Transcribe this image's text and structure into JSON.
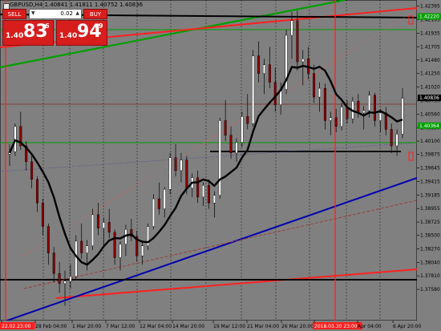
{
  "header": {
    "symbol_line": "GBPUSD,H4  1.40841 1.41811 1.40752 1.40836"
  },
  "trade_panel": {
    "sell_label": "SELL",
    "buy_label": "BUY",
    "lot_value": "0.02",
    "sell_price_small": "1.40",
    "sell_price_big": "83",
    "sell_price_sup": "6",
    "buy_price_small": "1.40",
    "buy_price_big": "94",
    "buy_price_sup": "9"
  },
  "colors": {
    "background": "#808080",
    "bull_candle": "#ffffff",
    "bear_candle": "#8b0000",
    "support_green": "#00a000",
    "resistance_red": "#ff2020",
    "trend_blue": "#0000b0",
    "moving_average": "#000000"
  },
  "chart_data": {
    "type": "candlestick",
    "symbol": "GBPUSD",
    "timeframe": "H4",
    "ylim": [
      1.3705,
      1.425
    ],
    "price_ticks": [
      "1.42395",
      "1.42165",
      "1.41935",
      "1.41705",
      "1.41480",
      "1.41250",
      "1.41020",
      "1.40790",
      "1.40560",
      "1.40330",
      "1.40100",
      "1.39875",
      "1.39645",
      "1.39415",
      "1.39185",
      "1.38955",
      "1.38725",
      "1.38500",
      "1.38270",
      "1.38040",
      "1.37810",
      "1.37580"
    ],
    "price_tags": [
      {
        "text": "1.42220",
        "price": 1.4222,
        "bg": "#00a000"
      },
      {
        "text": "1.40836",
        "price": 1.40836,
        "bg": "#000000"
      },
      {
        "text": "1.40364",
        "price": 1.40364,
        "bg": "#00a000"
      }
    ],
    "time_labels": [
      "22.02.23:00",
      "28 Feb 04:00",
      "1 Mar 20:00",
      "7 Mar 12:00",
      "12 Mar 04:00",
      "14 Mar 20:00",
      "19 Mar 12:00",
      "21 Mar 04:00",
      "26 Mar 20:00",
      "2018.03.30 23:00",
      "Apr 04:00",
      "6 Apr 20:00"
    ],
    "time_label_highlight": [
      "22.02.23:00",
      "2018.03.30 23:00"
    ],
    "ohlc": [
      [
        1.3988,
        1.4005,
        1.3968,
        1.3992
      ],
      [
        1.3992,
        1.404,
        1.3985,
        1.4035
      ],
      [
        1.4035,
        1.406,
        1.3995,
        1.4002
      ],
      [
        1.4002,
        1.401,
        1.396,
        1.3975
      ],
      [
        1.3975,
        1.399,
        1.393,
        1.3945
      ],
      [
        1.3945,
        1.395,
        1.389,
        1.3905
      ],
      [
        1.3905,
        1.3912,
        1.385,
        1.3865
      ],
      [
        1.3865,
        1.387,
        1.38,
        1.382
      ],
      [
        1.382,
        1.383,
        1.377,
        1.3785
      ],
      [
        1.3785,
        1.3805,
        1.3752,
        1.3768
      ],
      [
        1.3768,
        1.379,
        1.373,
        1.3772
      ],
      [
        1.3772,
        1.38,
        1.376,
        1.378
      ],
      [
        1.378,
        1.385,
        1.3775,
        1.384
      ],
      [
        1.384,
        1.387,
        1.381,
        1.382
      ],
      [
        1.382,
        1.3842,
        1.379,
        1.3832
      ],
      [
        1.3832,
        1.3895,
        1.3825,
        1.3885
      ],
      [
        1.3885,
        1.3905,
        1.385,
        1.3862
      ],
      [
        1.3862,
        1.388,
        1.383,
        1.3872
      ],
      [
        1.3872,
        1.3895,
        1.3845,
        1.3855
      ],
      [
        1.3855,
        1.386,
        1.38,
        1.3812
      ],
      [
        1.3812,
        1.384,
        1.379,
        1.3835
      ],
      [
        1.3835,
        1.3868,
        1.3815,
        1.386
      ],
      [
        1.386,
        1.3878,
        1.384,
        1.3848
      ],
      [
        1.3848,
        1.3858,
        1.3805,
        1.3815
      ],
      [
        1.3815,
        1.384,
        1.38,
        1.3832
      ],
      [
        1.3832,
        1.387,
        1.3825,
        1.3865
      ],
      [
        1.3865,
        1.392,
        1.386,
        1.3912
      ],
      [
        1.3912,
        1.394,
        1.3885,
        1.3895
      ],
      [
        1.3895,
        1.3932,
        1.388,
        1.3928
      ],
      [
        1.3928,
        1.399,
        1.392,
        1.3982
      ],
      [
        1.3982,
        1.4005,
        1.395,
        1.396
      ],
      [
        1.396,
        1.399,
        1.394,
        1.3978
      ],
      [
        1.3978,
        1.3985,
        1.392,
        1.393
      ],
      [
        1.393,
        1.3955,
        1.3915,
        1.3948
      ],
      [
        1.3948,
        1.396,
        1.3905,
        1.3915
      ],
      [
        1.3915,
        1.394,
        1.39,
        1.3935
      ],
      [
        1.3935,
        1.3945,
        1.3895,
        1.3905
      ],
      [
        1.3905,
        1.3925,
        1.388,
        1.3918
      ],
      [
        1.3918,
        1.405,
        1.3912,
        1.4045
      ],
      [
        1.4045,
        1.408,
        1.401,
        1.402
      ],
      [
        1.402,
        1.4035,
        1.398,
        1.399
      ],
      [
        1.399,
        1.4015,
        1.3975,
        1.4008
      ],
      [
        1.4008,
        1.406,
        1.4,
        1.4052
      ],
      [
        1.4052,
        1.409,
        1.403,
        1.404
      ],
      [
        1.404,
        1.4165,
        1.4035,
        1.4155
      ],
      [
        1.4155,
        1.418,
        1.411,
        1.4125
      ],
      [
        1.4125,
        1.415,
        1.409,
        1.414
      ],
      [
        1.414,
        1.417,
        1.41,
        1.411
      ],
      [
        1.411,
        1.4135,
        1.406,
        1.4072
      ],
      [
        1.4072,
        1.411,
        1.4055,
        1.4098
      ],
      [
        1.4098,
        1.42,
        1.409,
        1.419
      ],
      [
        1.419,
        1.423,
        1.415,
        1.4215
      ],
      [
        1.4215,
        1.4232,
        1.413,
        1.4145
      ],
      [
        1.4145,
        1.4165,
        1.4105,
        1.415
      ],
      [
        1.415,
        1.417,
        1.4115,
        1.4125
      ],
      [
        1.4125,
        1.414,
        1.4075,
        1.4085
      ],
      [
        1.4085,
        1.411,
        1.406,
        1.41
      ],
      [
        1.41,
        1.4108,
        1.403,
        1.4045
      ],
      [
        1.4045,
        1.406,
        1.402,
        1.405
      ],
      [
        1.405,
        1.4065,
        1.4025,
        1.4035
      ],
      [
        1.4035,
        1.4075,
        1.4028,
        1.4068
      ],
      [
        1.4068,
        1.408,
        1.404,
        1.4048
      ],
      [
        1.4048,
        1.4085,
        1.404,
        1.4078
      ],
      [
        1.4078,
        1.409,
        1.405,
        1.4058
      ],
      [
        1.4058,
        1.407,
        1.403,
        1.4062
      ],
      [
        1.4062,
        1.4095,
        1.405,
        1.4088
      ],
      [
        1.4088,
        1.4092,
        1.4035,
        1.4045
      ],
      [
        1.4045,
        1.4065,
        1.4025,
        1.4058
      ],
      [
        1.4058,
        1.4068,
        1.402,
        1.403
      ],
      [
        1.403,
        1.404,
        1.399,
        1.4002
      ],
      [
        1.4002,
        1.403,
        1.3985,
        1.4022
      ],
      [
        1.4022,
        1.41,
        1.4015,
        1.4083
      ]
    ],
    "lines": [
      {
        "name": "green-upper-trendline",
        "color": "#00a000"
      },
      {
        "name": "green-horizontal-upper",
        "color": "#00a000"
      },
      {
        "name": "green-horizontal-lower",
        "color": "#00a000"
      },
      {
        "name": "red-upper-trendline",
        "color": "#ff2020"
      },
      {
        "name": "red-lower-trendline",
        "color": "#ff2020"
      },
      {
        "name": "blue-trendline",
        "color": "#0000b0"
      },
      {
        "name": "black-moving-average",
        "color": "#000000"
      }
    ]
  }
}
